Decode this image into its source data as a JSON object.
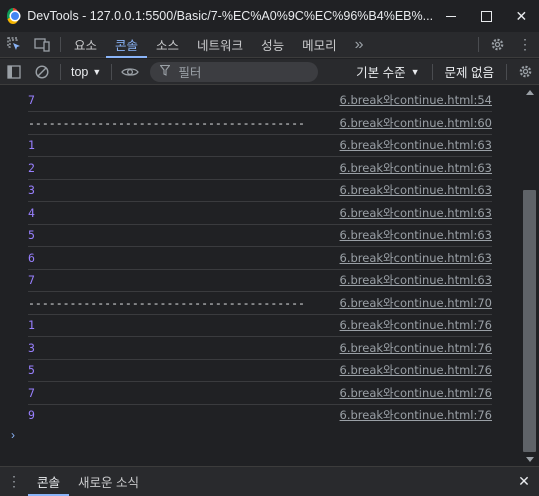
{
  "window": {
    "title": "DevTools - 127.0.0.1:5500/Basic/7-%EC%A0%9C%EC%96%B4%EB%..."
  },
  "tabs": [
    {
      "label": "요소"
    },
    {
      "label": "콘솔"
    },
    {
      "label": "소스"
    },
    {
      "label": "네트워크"
    },
    {
      "label": "성능"
    },
    {
      "label": "메모리"
    }
  ],
  "more_tabs": "»",
  "toolbar": {
    "context": "top",
    "filter_placeholder": "필터",
    "level": "기본 수준",
    "issues": "문제 없음"
  },
  "console_rows": [
    {
      "value": "7",
      "type": "number",
      "source": "6.break와continue.html:54"
    },
    {
      "value": "----------------------------------------",
      "type": "string",
      "source": "6.break와continue.html:60"
    },
    {
      "value": "1",
      "type": "number",
      "source": "6.break와continue.html:63"
    },
    {
      "value": "2",
      "type": "number",
      "source": "6.break와continue.html:63"
    },
    {
      "value": "3",
      "type": "number",
      "source": "6.break와continue.html:63"
    },
    {
      "value": "4",
      "type": "number",
      "source": "6.break와continue.html:63"
    },
    {
      "value": "5",
      "type": "number",
      "source": "6.break와continue.html:63"
    },
    {
      "value": "6",
      "type": "number",
      "source": "6.break와continue.html:63"
    },
    {
      "value": "7",
      "type": "number",
      "source": "6.break와continue.html:63"
    },
    {
      "value": "----------------------------------------",
      "type": "string",
      "source": "6.break와continue.html:70"
    },
    {
      "value": "1",
      "type": "number",
      "source": "6.break와continue.html:76"
    },
    {
      "value": "3",
      "type": "number",
      "source": "6.break와continue.html:76"
    },
    {
      "value": "5",
      "type": "number",
      "source": "6.break와continue.html:76"
    },
    {
      "value": "7",
      "type": "number",
      "source": "6.break와continue.html:76"
    },
    {
      "value": "9",
      "type": "number",
      "source": "6.break와continue.html:76"
    }
  ],
  "prompt": "›",
  "drawer": {
    "tabs": [
      {
        "label": "콘솔"
      },
      {
        "label": "새로운 소식"
      }
    ],
    "close": "✕"
  },
  "colors": {
    "number": "#9980ff",
    "accent": "#8ab4f8",
    "background": "#202124"
  }
}
